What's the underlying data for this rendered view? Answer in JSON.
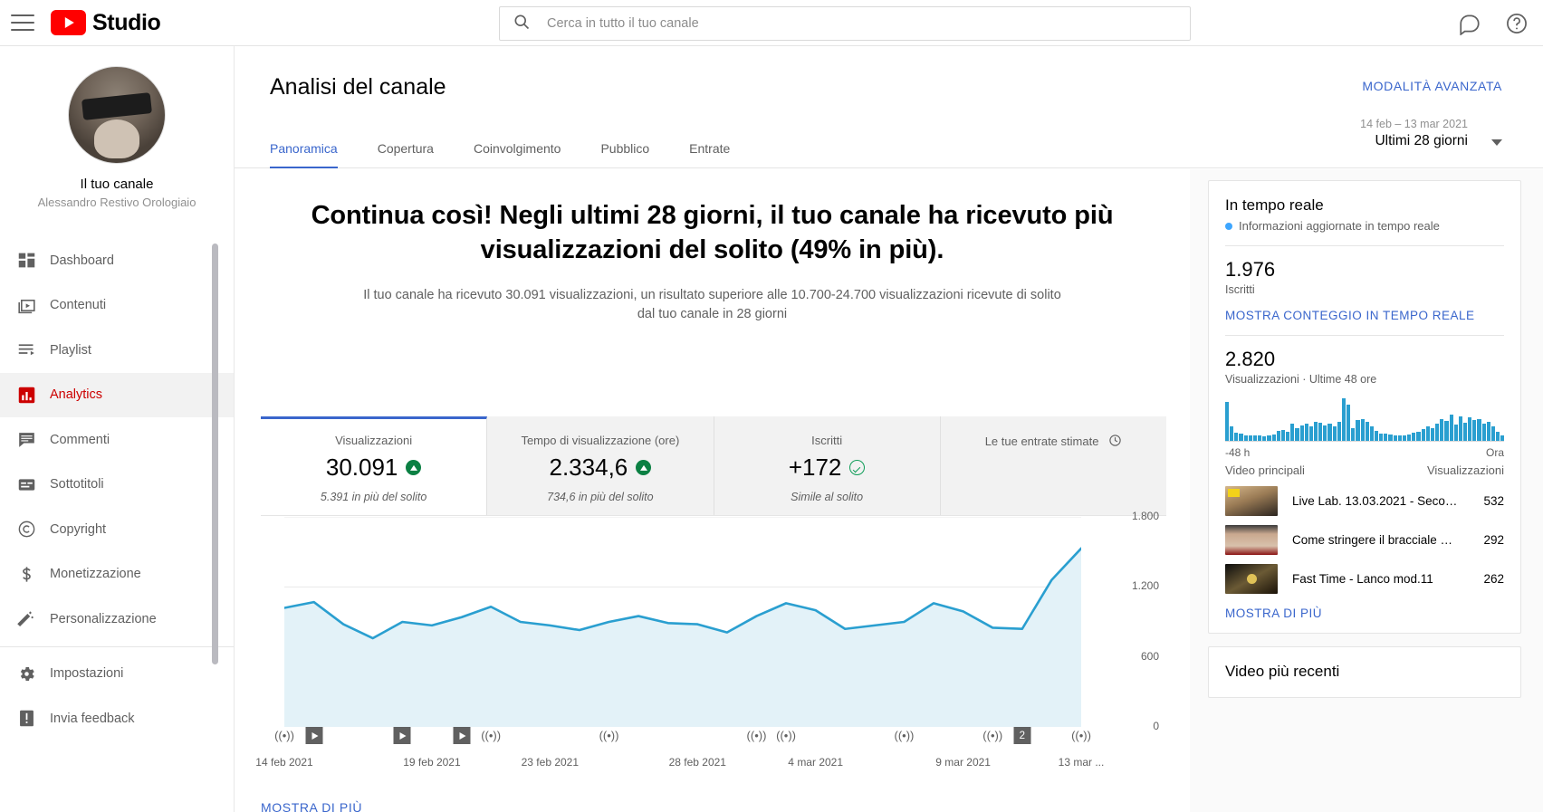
{
  "topbar": {
    "menu_icon": "hamburger-icon",
    "brand": "Studio",
    "search_placeholder": "Cerca in tutto il tuo canale",
    "search_value": "",
    "search_icon": "search-icon",
    "feedback_icon": "feedback-icon",
    "help_icon": "help-icon"
  },
  "sidebar": {
    "channel_label": "Il tuo canale",
    "channel_name": "Alessandro Restivo Orologiaio",
    "items": [
      {
        "label": "Dashboard",
        "icon": "dashboard-icon",
        "active": false
      },
      {
        "label": "Contenuti",
        "icon": "content-video-icon",
        "active": false
      },
      {
        "label": "Playlist",
        "icon": "playlist-icon",
        "active": false
      },
      {
        "label": "Analytics",
        "icon": "analytics-bar-icon",
        "active": true
      },
      {
        "label": "Commenti",
        "icon": "comment-icon",
        "active": false
      },
      {
        "label": "Sottotitoli",
        "icon": "subtitles-icon",
        "active": false
      },
      {
        "label": "Copyright",
        "icon": "copyright-icon",
        "active": false
      },
      {
        "label": "Monetizzazione",
        "icon": "dollar-icon",
        "active": false
      },
      {
        "label": "Personalizzazione",
        "icon": "magic-wand-icon",
        "active": false
      }
    ],
    "footer_items": [
      {
        "label": "Impostazioni",
        "icon": "gear-icon"
      },
      {
        "label": "Invia feedback",
        "icon": "feedback-alert-icon"
      }
    ]
  },
  "header": {
    "title": "Analisi del canale",
    "advanced_mode": "MODALITÀ AVANZATA",
    "date_range_sub": "14 feb – 13 mar 2021",
    "date_range_main": "Ultimi 28 giorni",
    "caret_icon": "chevron-down-icon",
    "tabs": [
      {
        "label": "Panoramica",
        "active": true
      },
      {
        "label": "Copertura",
        "active": false
      },
      {
        "label": "Coinvolgimento",
        "active": false
      },
      {
        "label": "Pubblico",
        "active": false
      },
      {
        "label": "Entrate",
        "active": false
      }
    ]
  },
  "hero": {
    "headline": "Continua così! Negli ultimi 28 giorni, il tuo canale ha ricevuto più visualizzazioni del solito (49% in più).",
    "subline": "Il tuo canale ha ricevuto 30.091 visualizzazioni, un risultato superiore alle 10.700-24.700 visualizzazioni ricevute di solito dal tuo canale in 28 giorni"
  },
  "metric_cards": [
    {
      "label": "Visualizzazioni",
      "value": "30.091",
      "badge": "up",
      "sub": "5.391 in più del solito",
      "selected": true
    },
    {
      "label": "Tempo di visualizzazione (ore)",
      "value": "2.334,6",
      "badge": "up",
      "sub": "734,6 in più del solito",
      "selected": false
    },
    {
      "label": "Iscritti",
      "value": "+172",
      "badge": "ok",
      "sub": "Simile al solito",
      "selected": false
    },
    {
      "label": "Le tue entrate stimate",
      "value": "",
      "badge": "none",
      "sub": "",
      "selected": false,
      "label_icon": "clock-icon"
    }
  ],
  "chart_data": {
    "type": "area",
    "title": "Visualizzazioni",
    "xlabel": "",
    "ylabel": "",
    "ylim": [
      0,
      1800
    ],
    "yticks": [
      0,
      600,
      1200,
      1800
    ],
    "ytick_labels": [
      "0",
      "600",
      "1.200",
      "1.800"
    ],
    "grid": true,
    "legend": "none",
    "line_color": "#2a9fd0",
    "fill_color": "#e3f2f8",
    "x_tick_labels": [
      "14 feb 2021",
      "19 feb 2021",
      "23 feb 2021",
      "28 feb 2021",
      "4 mar 2021",
      "9 mar 2021",
      "13 mar ..."
    ],
    "x_tick_positions": [
      0,
      5,
      9,
      14,
      18,
      23,
      27
    ],
    "x": [
      "14 feb 2021",
      "15 feb 2021",
      "16 feb 2021",
      "17 feb 2021",
      "18 feb 2021",
      "19 feb 2021",
      "20 feb 2021",
      "21 feb 2021",
      "22 feb 2021",
      "23 feb 2021",
      "24 feb 2021",
      "25 feb 2021",
      "26 feb 2021",
      "27 feb 2021",
      "28 feb 2021",
      "1 mar 2021",
      "2 mar 2021",
      "3 mar 2021",
      "4 mar 2021",
      "5 mar 2021",
      "6 mar 2021",
      "7 mar 2021",
      "8 mar 2021",
      "9 mar 2021",
      "10 mar 2021",
      "11 mar 2021",
      "12 mar 2021",
      "13 mar 2021"
    ],
    "values": [
      1020,
      1070,
      880,
      760,
      900,
      870,
      940,
      1030,
      900,
      870,
      830,
      900,
      950,
      890,
      880,
      810,
      950,
      1060,
      1000,
      840,
      870,
      900,
      1060,
      990,
      850,
      840,
      1260,
      1530
    ],
    "event_markers": [
      {
        "x_index": 0,
        "type": "live",
        "icon": "live-broadcast-icon"
      },
      {
        "x_index": 1,
        "type": "video",
        "icon": "play-icon"
      },
      {
        "x_index": 4,
        "type": "video",
        "icon": "play-icon"
      },
      {
        "x_index": 6,
        "type": "video",
        "icon": "play-icon"
      },
      {
        "x_index": 7,
        "type": "live",
        "icon": "live-broadcast-icon"
      },
      {
        "x_index": 11,
        "type": "live",
        "icon": "live-broadcast-icon"
      },
      {
        "x_index": 16,
        "type": "live",
        "icon": "live-broadcast-icon"
      },
      {
        "x_index": 17,
        "type": "live",
        "icon": "live-broadcast-icon"
      },
      {
        "x_index": 21,
        "type": "live",
        "icon": "live-broadcast-icon"
      },
      {
        "x_index": 24,
        "type": "live",
        "icon": "live-broadcast-icon"
      },
      {
        "x_index": 25,
        "type": "count",
        "label": "2"
      },
      {
        "x_index": 27,
        "type": "live",
        "icon": "live-broadcast-icon"
      }
    ]
  },
  "show_more_chart": "MOSTRA DI PIÙ",
  "realtime": {
    "title": "In tempo reale",
    "live_note": "Informazioni aggiornate in tempo reale",
    "subscribers_value": "1.976",
    "subscribers_label": "Iscritti",
    "show_realtime_link": "MOSTRA CONTEGGIO IN TEMPO REALE",
    "views_value": "2.820",
    "views_label": "Visualizzazioni · Ultime 48 ore",
    "spark_left_label": "-48 h",
    "spark_right_label": "Ora",
    "spark_values": [
      92,
      34,
      20,
      16,
      13,
      12,
      12,
      12,
      10,
      12,
      14,
      24,
      26,
      22,
      40,
      30,
      36,
      40,
      34,
      44,
      42,
      36,
      40,
      34,
      44,
      100,
      86,
      30,
      50,
      52,
      44,
      34,
      24,
      18,
      16,
      14,
      12,
      12,
      12,
      14,
      20,
      22,
      28,
      34,
      30,
      40,
      52,
      46,
      62,
      38,
      58,
      42,
      56,
      48,
      52,
      40,
      44,
      34,
      22,
      12
    ],
    "table_header_left": "Video principali",
    "table_header_right": "Visualizzazioni",
    "videos": [
      {
        "title": "Live Lab. 13.03.2021 - Seco…",
        "views": "532",
        "thumb": "vt1"
      },
      {
        "title": "Come stringere il bracciale …",
        "views": "292",
        "thumb": "vt2"
      },
      {
        "title": "Fast Time - Lanco mod.11",
        "views": "262",
        "thumb": "vt3"
      }
    ],
    "show_more": "MOSTRA DI PIÙ"
  },
  "recent_videos": {
    "title": "Video più recenti"
  }
}
